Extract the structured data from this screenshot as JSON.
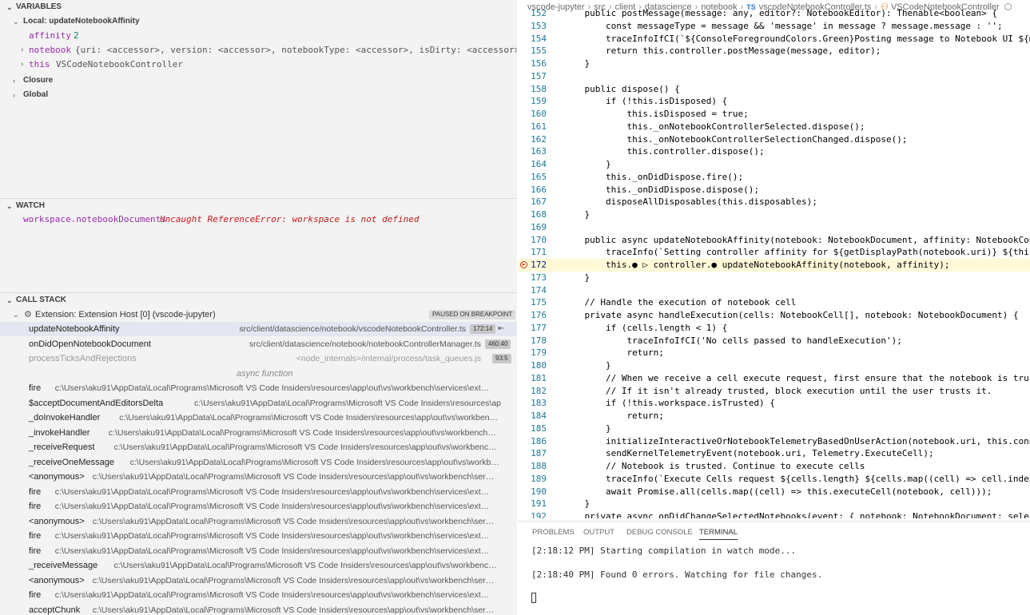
{
  "variables": {
    "header": "VARIABLES",
    "local_scope": "Local: updateNotebookAffinity",
    "items": [
      {
        "name": "affinity",
        "value": "2"
      },
      {
        "name": "notebook",
        "value": "{uri: <accessor>, version: <accessor>, notebookType: <accessor>, isDirty: <accessor>, isUnt…"
      },
      {
        "name": "this",
        "value": "VSCodeNotebookController"
      }
    ],
    "closure": "Closure",
    "global": "Global"
  },
  "watch": {
    "header": "WATCH",
    "expression": "workspace.notebookDocuments",
    "error": "Uncaught ReferenceError: workspace is not defined"
  },
  "call_stack": {
    "header": "CALL STACK",
    "thread": "Extension: Extension Host [0] (vscode-jupyter)",
    "status": "PAUSED ON BREAKPOINT",
    "frames": [
      {
        "fn": "updateNotebookAffinity",
        "path": "src/client/datascience/notebook/vscodeNotebookController.ts",
        "loc": "172:14"
      },
      {
        "fn": "onDidOpenNotebookDocument",
        "path": "src/client/datascience/notebook/notebookControllerManager.ts",
        "loc": "460:40"
      },
      {
        "fn": "processTicksAndRejections",
        "path": "<node_internals>/internal/process/task_queues.js",
        "loc": "93:5"
      },
      {
        "fn": "async function",
        "path": "",
        "loc": ""
      },
      {
        "fn": "fire",
        "path": "c:\\Users\\aku91\\AppData\\Local\\Programs\\Microsoft VS Code Insiders\\resources\\app\\out\\vs\\workbench\\services\\ext…",
        "loc": ""
      },
      {
        "fn": "$acceptDocumentAndEditorsDelta",
        "path": "c:\\Users\\aku91\\AppData\\Local\\Programs\\Microsoft VS Code Insiders\\resources\\ap…",
        "loc": ""
      },
      {
        "fn": "_doInvokeHandler",
        "path": "c:\\Users\\aku91\\AppData\\Local\\Programs\\Microsoft VS Code Insiders\\resources\\app\\out\\vs\\workben…",
        "loc": ""
      },
      {
        "fn": "_invokeHandler",
        "path": "c:\\Users\\aku91\\AppData\\Local\\Programs\\Microsoft VS Code Insiders\\resources\\app\\out\\vs\\workbench…",
        "loc": ""
      },
      {
        "fn": "_receiveRequest",
        "path": "c:\\Users\\aku91\\AppData\\Local\\Programs\\Microsoft VS Code Insiders\\resources\\app\\out\\vs\\workbenc…",
        "loc": ""
      },
      {
        "fn": "_receiveOneMessage",
        "path": "c:\\Users\\aku91\\AppData\\Local\\Programs\\Microsoft VS Code Insiders\\resources\\app\\out\\vs\\workb…",
        "loc": ""
      },
      {
        "fn": "<anonymous>",
        "path": "c:\\Users\\aku91\\AppData\\Local\\Programs\\Microsoft VS Code Insiders\\resources\\app\\out\\vs\\workbench\\ser…",
        "loc": ""
      },
      {
        "fn": "fire",
        "path": "c:\\Users\\aku91\\AppData\\Local\\Programs\\Microsoft VS Code Insiders\\resources\\app\\out\\vs\\workbench\\services\\ext…",
        "loc": ""
      },
      {
        "fn": "fire",
        "path": "c:\\Users\\aku91\\AppData\\Local\\Programs\\Microsoft VS Code Insiders\\resources\\app\\out\\vs\\workbench\\services\\ext…",
        "loc": ""
      },
      {
        "fn": "<anonymous>",
        "path": "c:\\Users\\aku91\\AppData\\Local\\Programs\\Microsoft VS Code Insiders\\resources\\app\\out\\vs\\workbench\\ser…",
        "loc": ""
      },
      {
        "fn": "fire",
        "path": "c:\\Users\\aku91\\AppData\\Local\\Programs\\Microsoft VS Code Insiders\\resources\\app\\out\\vs\\workbench\\services\\ext…",
        "loc": ""
      },
      {
        "fn": "fire",
        "path": "c:\\Users\\aku91\\AppData\\Local\\Programs\\Microsoft VS Code Insiders\\resources\\app\\out\\vs\\workbench\\services\\ext…",
        "loc": ""
      },
      {
        "fn": "_receiveMessage",
        "path": "c:\\Users\\aku91\\AppData\\Local\\Programs\\Microsoft VS Code Insiders\\resources\\app\\out\\vs\\workbenc…",
        "loc": ""
      },
      {
        "fn": "<anonymous>",
        "path": "c:\\Users\\aku91\\AppData\\Local\\Programs\\Microsoft VS Code Insiders\\resources\\app\\out\\vs\\workbench\\ser…",
        "loc": ""
      },
      {
        "fn": "fire",
        "path": "c:\\Users\\aku91\\AppData\\Local\\Programs\\Microsoft VS Code Insiders\\resources\\app\\out\\vs\\workbench\\services\\ext…",
        "loc": ""
      },
      {
        "fn": "acceptChunk",
        "path": "c:\\Users\\aku91\\AppData\\Local\\Programs\\Microsoft VS Code Insiders\\resources\\app\\out\\vs\\workbench\\ser…",
        "loc": ""
      }
    ]
  },
  "breadcrumb": [
    "vscode-jupyter",
    "src",
    "client",
    "datascience",
    "notebook",
    "vscodeNotebookController.ts",
    "VSCodeNotebookController"
  ],
  "breadcrumb_ts_badge": "TS",
  "code": {
    "lines": [
      {
        "n": "152",
        "t": "    public postMessage(message: any, editor?: NotebookEditor): Thenable<boolean> {"
      },
      {
        "n": "153",
        "t": "        const messageType = message && 'message' in message ? message.message : '';"
      },
      {
        "n": "154",
        "t": "        traceInfoIfCI(`${ConsoleForegroundColors.Green}Posting message to Notebook UI ${mes"
      },
      {
        "n": "155",
        "t": "        return this.controller.postMessage(message, editor);"
      },
      {
        "n": "156",
        "t": "    }"
      },
      {
        "n": "157",
        "t": ""
      },
      {
        "n": "158",
        "t": "    public dispose() {"
      },
      {
        "n": "159",
        "t": "        if (!this.isDisposed) {"
      },
      {
        "n": "160",
        "t": "            this.isDisposed = true;"
      },
      {
        "n": "161",
        "t": "            this._onNotebookControllerSelected.dispose();"
      },
      {
        "n": "162",
        "t": "            this._onNotebookControllerSelectionChanged.dispose();"
      },
      {
        "n": "163",
        "t": "            this.controller.dispose();"
      },
      {
        "n": "164",
        "t": "        }"
      },
      {
        "n": "165",
        "t": "        this._onDidDispose.fire();"
      },
      {
        "n": "166",
        "t": "        this._onDidDispose.dispose();"
      },
      {
        "n": "167",
        "t": "        disposeAllDisposables(this.disposables);"
      },
      {
        "n": "168",
        "t": "    }"
      },
      {
        "n": "169",
        "t": ""
      },
      {
        "n": "170",
        "t": "    public async updateNotebookAffinity(notebook: NotebookDocument, affinity: NotebookContro"
      },
      {
        "n": "171",
        "t": "        traceInfo(`Setting controller affinity for ${getDisplayPath(notebook.uri)} ${this.i"
      },
      {
        "n": "172",
        "t": "        this.● ▷ controller.● updateNotebookAffinity(notebook, affinity);"
      },
      {
        "n": "173",
        "t": "    }"
      },
      {
        "n": "174",
        "t": ""
      },
      {
        "n": "175",
        "t": "    // Handle the execution of notebook cell"
      },
      {
        "n": "176",
        "t": "    private async handleExecution(cells: NotebookCell[], notebook: NotebookDocument) {"
      },
      {
        "n": "177",
        "t": "        if (cells.length < 1) {"
      },
      {
        "n": "178",
        "t": "            traceInfoIfCI('No cells passed to handleExecution');"
      },
      {
        "n": "179",
        "t": "            return;"
      },
      {
        "n": "180",
        "t": "        }"
      },
      {
        "n": "181",
        "t": "        // When we receive a cell execute request, first ensure that the notebook is truste"
      },
      {
        "n": "182",
        "t": "        // If it isn't already trusted, block execution until the user trusts it."
      },
      {
        "n": "183",
        "t": "        if (!this.workspace.isTrusted) {"
      },
      {
        "n": "184",
        "t": "            return;"
      },
      {
        "n": "185",
        "t": "        }"
      },
      {
        "n": "186",
        "t": "        initializeInteractiveOrNotebookTelemetryBasedOnUserAction(notebook.uri, this.connec"
      },
      {
        "n": "187",
        "t": "        sendKernelTelemetryEvent(notebook.uri, Telemetry.ExecuteCell);"
      },
      {
        "n": "188",
        "t": "        // Notebook is trusted. Continue to execute cells"
      },
      {
        "n": "189",
        "t": "        traceInfo(`Execute Cells request ${cells.length} ${cells.map((cell) => cell.index)."
      },
      {
        "n": "190",
        "t": "        await Promise.all(cells.map((cell) => this.executeCell(notebook, cell)));"
      },
      {
        "n": "191",
        "t": "    }"
      },
      {
        "n": "192",
        "t": "    private async onDidChangeSelectedNotebooks(event: { notebook: NotebookDocument; selected"
      }
    ]
  },
  "panel": {
    "tabs": [
      "PROBLEMS",
      "OUTPUT",
      "DEBUG CONSOLE",
      "TERMINAL"
    ],
    "active_tab": "TERMINAL",
    "terminal_lines": [
      "[2:18:12 PM] Starting compilation in watch mode...",
      "[2:18:40 PM] Found 0 errors. Watching for file changes."
    ]
  }
}
